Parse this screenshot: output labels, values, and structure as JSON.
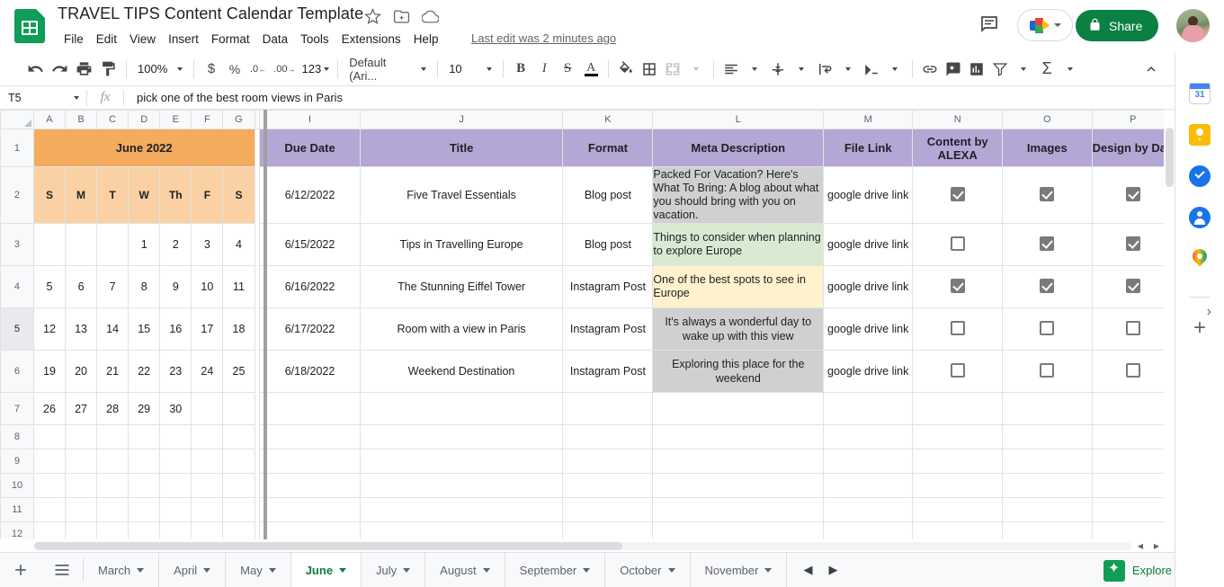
{
  "app": {
    "logo_icon": "sheets-logo-icon",
    "doc_title": "TRAVEL TIPS Content Calendar Template",
    "title_icons": [
      "star-icon",
      "move-to-folder-icon",
      "cloud-saved-icon"
    ],
    "last_edit": "Last edit was 2 minutes ago",
    "menus": [
      "File",
      "Edit",
      "View",
      "Insert",
      "Format",
      "Data",
      "Tools",
      "Extensions",
      "Help"
    ],
    "comment_icon": "comment-history-icon",
    "meet_icon": "google-meet-icon",
    "share_label": "Share",
    "share_lock_icon": "lock-icon",
    "avatar_icon": "user-avatar"
  },
  "toolbar": {
    "undo_icon": "undo-icon",
    "redo_icon": "redo-icon",
    "print_icon": "print-icon",
    "paint_icon": "paint-format-icon",
    "zoom_value": "100%",
    "currency_icon": "currency-dollar-icon",
    "percent_icon": "percent-icon",
    "decimal_decrease_icon": "decrease-decimal-icon",
    "decimal_increase_icon": "increase-decimal-icon",
    "number_format_label": "123",
    "font_value": "Default (Ari...",
    "font_size_value": "10",
    "bold_label": "B",
    "italic_label": "I",
    "strikethrough_label": "S",
    "text_color_label": "A",
    "fill_color_icon": "fill-color-icon",
    "borders_icon": "borders-icon",
    "merge_icon": "merge-cells-icon",
    "halign_icon": "horizontal-align-icon",
    "valign_icon": "vertical-align-icon",
    "wrap_icon": "text-wrap-icon",
    "rotate_icon": "text-rotation-icon",
    "link_icon": "insert-link-icon",
    "comment_icon": "insert-comment-icon",
    "chart_icon": "insert-chart-icon",
    "filter_icon": "filter-icon",
    "functions_label": "Σ",
    "collapse_icon": "collapse-toolbar-icon"
  },
  "formula_bar": {
    "name_box": "T5",
    "fx_label": "fx",
    "formula_value": "pick one of the best room views in Paris"
  },
  "grid": {
    "column_headers": [
      "A",
      "B",
      "C",
      "D",
      "E",
      "F",
      "G",
      "",
      "I",
      "J",
      "K",
      "L",
      "M",
      "N",
      "O",
      "P"
    ],
    "row_headers": [
      "1",
      "2",
      "3",
      "4",
      "5",
      "6",
      "7",
      "8",
      "9",
      "10",
      "11",
      "12"
    ],
    "selected_row": "5",
    "calendar": {
      "title": "June 2022",
      "dow": [
        "S",
        "M",
        "T",
        "W",
        "Th",
        "F",
        "S"
      ],
      "weeks": [
        [
          "",
          "",
          "",
          "1",
          "2",
          "3",
          "4"
        ],
        [
          "5",
          "6",
          "7",
          "8",
          "9",
          "10",
          "11"
        ],
        [
          "12",
          "13",
          "14",
          "15",
          "16",
          "17",
          "18"
        ],
        [
          "19",
          "20",
          "21",
          "22",
          "23",
          "24",
          "25"
        ],
        [
          "26",
          "27",
          "28",
          "29",
          "30",
          "",
          ""
        ]
      ]
    },
    "table_headers": [
      "Due Date",
      "Title",
      "Format",
      "Meta Description",
      "File Link",
      "Content by ALEXA",
      "Images",
      "Design by Dan"
    ],
    "rows": [
      {
        "due_date": "6/12/2022",
        "title": "Five Travel Essentials",
        "format": "Blog post",
        "meta": "Packed For Vacation? Here's What To Bring: A blog about what you should bring with you on vacation.",
        "meta_bg": "#d0d0d0",
        "meta_align": "left",
        "file_link": "google drive link",
        "content_by_alexa": true,
        "images": true,
        "design_by_dan": true
      },
      {
        "due_date": "6/15/2022",
        "title": "Tips in Travelling Europe",
        "format": "Blog post",
        "meta": "Things to consider when planning to explore Europe",
        "meta_bg": "#d9ead3",
        "meta_align": "left",
        "file_link": "google drive link",
        "content_by_alexa": false,
        "images": true,
        "design_by_dan": true
      },
      {
        "due_date": "6/16/2022",
        "title": "The Stunning Eiffel Tower",
        "format": "Instagram Post",
        "meta": "One of the best spots to see in Europe",
        "meta_bg": "#fff2cc",
        "meta_align": "left",
        "file_link": "google drive link",
        "content_by_alexa": true,
        "images": true,
        "design_by_dan": true
      },
      {
        "due_date": "6/17/2022",
        "title": "Room with a view in Paris",
        "format": "Instagram Post",
        "meta": "It's always a wonderful day to wake up with this view",
        "meta_bg": "#d0d0d0",
        "meta_align": "center",
        "file_link": "google drive link",
        "content_by_alexa": false,
        "images": false,
        "design_by_dan": false
      },
      {
        "due_date": "6/18/2022",
        "title": "Weekend Destination",
        "format": "Instagram Post",
        "meta": "Exploring this place for the weekend",
        "meta_bg": "#d0d0d0",
        "meta_align": "center",
        "file_link": "google drive link",
        "content_by_alexa": false,
        "images": false,
        "design_by_dan": false
      }
    ]
  },
  "sheet_tabs": {
    "add_icon": "add-sheet-icon",
    "all_sheets_icon": "all-sheets-icon",
    "tabs": [
      "March",
      "April",
      "May",
      "June",
      "July",
      "August",
      "September",
      "October",
      "November"
    ],
    "active_tab": "June",
    "prev_icon": "previous-sheet-icon",
    "next_icon": "next-sheet-icon",
    "explore_label": "Explore",
    "explore_icon": "explore-icon"
  },
  "side_panel": {
    "icons": [
      "google-calendar-icon",
      "google-keep-icon",
      "google-tasks-icon",
      "google-contacts-icon",
      "google-maps-icon"
    ],
    "add_icon": "add-on-plus-icon",
    "collapse_icon": "expand-panel-chevron-icon"
  },
  "colors": {
    "brand_green": "#0f9d58",
    "share_green": "#0b8043",
    "header_purple": "#b4a7d6",
    "calendar_orange": "#f5ab5e",
    "calendar_orange_light": "#fad0a5"
  }
}
